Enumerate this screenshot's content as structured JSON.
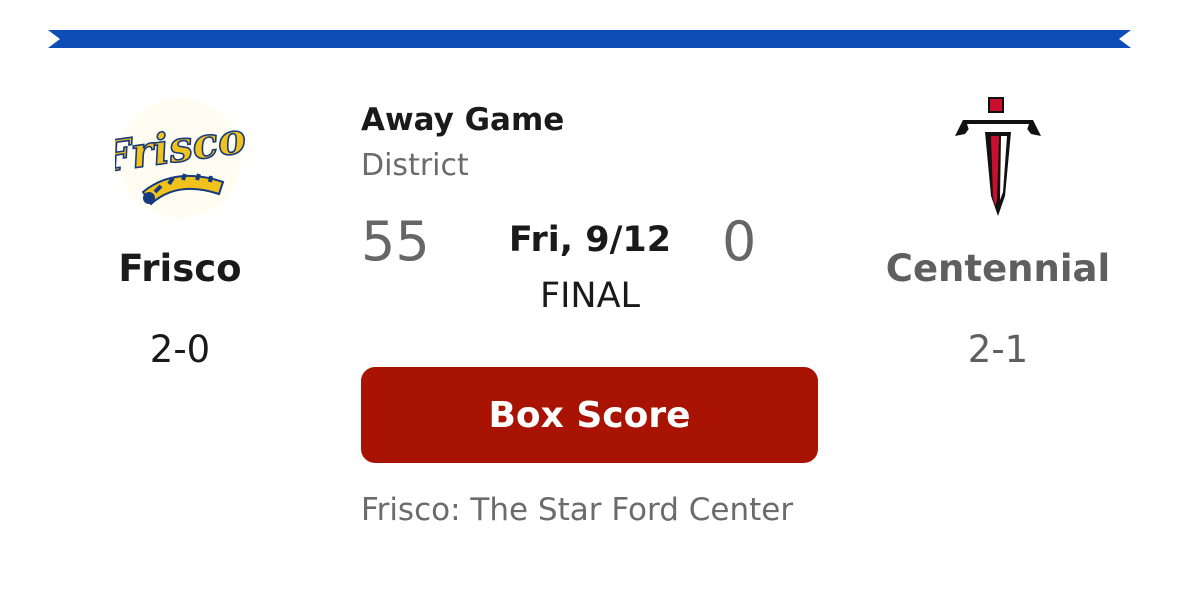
{
  "colors": {
    "banner": "#0d4db5",
    "button": "#a91303",
    "frisco_gold": "#f1c21b",
    "frisco_navy": "#163a7e",
    "centennial_red": "#c8102e",
    "centennial_black": "#111111"
  },
  "game": {
    "type": "Away Game",
    "subtype": "District",
    "date": "Fri, 9/12",
    "status": "FINAL",
    "venue": "Frisco: The Star Ford Center"
  },
  "home_team": {
    "name": "Frisco",
    "record": "2-0",
    "score": "55",
    "logo_icon": "frisco-logo-icon",
    "logo_text": "Frisco"
  },
  "away_team": {
    "name": "Centennial",
    "record": "2-1",
    "score": "0",
    "logo_icon": "centennial-sword-logo-icon"
  },
  "actions": {
    "box_score_label": "Box Score"
  }
}
